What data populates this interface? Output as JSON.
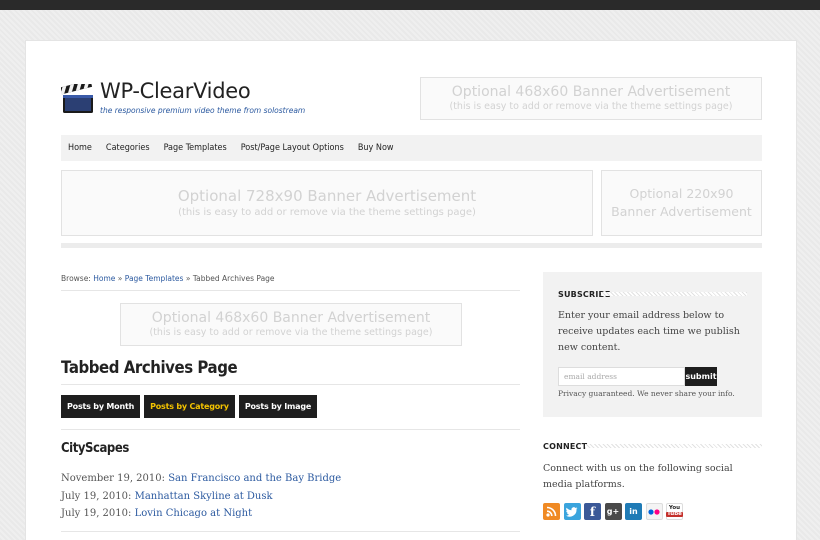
{
  "site": {
    "title": "WP-ClearVideo",
    "tagline": "the responsive premium video theme from solostream"
  },
  "ads": {
    "header": {
      "line1": "Optional 468x60 Banner Advertisement",
      "line2": "(this is easy to add or remove via the theme settings page)"
    },
    "leaderboard": {
      "line1": "Optional 728x90 Banner Advertisement",
      "line2": "(this is easy to add or remove via the theme settings page)"
    },
    "square": {
      "line1": "Optional 220x90",
      "line2": "Banner Advertisement"
    },
    "content": {
      "line1": "Optional 468x60 Banner Advertisement",
      "line2": "(this is easy to add or remove via the theme settings page)"
    }
  },
  "nav": {
    "items": [
      {
        "label": "Home"
      },
      {
        "label": "Categories"
      },
      {
        "label": "Page Templates"
      },
      {
        "label": "Post/Page Layout Options"
      },
      {
        "label": "Buy Now"
      }
    ]
  },
  "breadcrumb": {
    "prefix": "Browse:",
    "home": "Home",
    "sep1": "»",
    "parent": "Page Templates",
    "sep2": "»",
    "current": "Tabbed Archives Page"
  },
  "page": {
    "title": "Tabbed Archives Page",
    "tabs": [
      {
        "label": "Posts by Month",
        "active": false
      },
      {
        "label": "Posts by Category",
        "active": true
      },
      {
        "label": "Posts by Image",
        "active": false
      }
    ],
    "section": "CityScapes",
    "posts": [
      {
        "date": "November 19, 2010:",
        "title": "San Francisco and the Bay Bridge"
      },
      {
        "date": "July 19, 2010:",
        "title": "Manhattan Skyline at Dusk"
      },
      {
        "date": "July 19, 2010:",
        "title": "Lovin Chicago at Night"
      }
    ]
  },
  "sidebar": {
    "subscribe": {
      "title": "SUBSCRIBE",
      "text": "Enter your email address below to receive updates each time we publish new content.",
      "placeholder": "email address",
      "button": "submit",
      "privacy": "Privacy guaranteed. We never share your info."
    },
    "connect": {
      "title": "CONNECT",
      "text": "Connect with us on the following social media platforms.",
      "icons": [
        {
          "name": "rss-icon",
          "glyph": "◉",
          "color": "#f08a24"
        },
        {
          "name": "twitter-icon",
          "glyph": "t",
          "color": "#3aa4dd"
        },
        {
          "name": "facebook-icon",
          "glyph": "f",
          "color": "#3b5998"
        },
        {
          "name": "googleplus-icon",
          "glyph": "g+",
          "color": "#4a4a4a"
        },
        {
          "name": "linkedin-icon",
          "glyph": "in",
          "color": "#1f7bb6"
        },
        {
          "name": "flickr-icon",
          "glyph": "●●",
          "color": "#f4f4f4"
        },
        {
          "name": "youtube-icon",
          "glyph": "You",
          "color": "#c4302b"
        }
      ]
    }
  },
  "colors": {
    "link": "#2c5aa0",
    "activeTab": "#f2c200",
    "dark": "#1e1e1e"
  }
}
